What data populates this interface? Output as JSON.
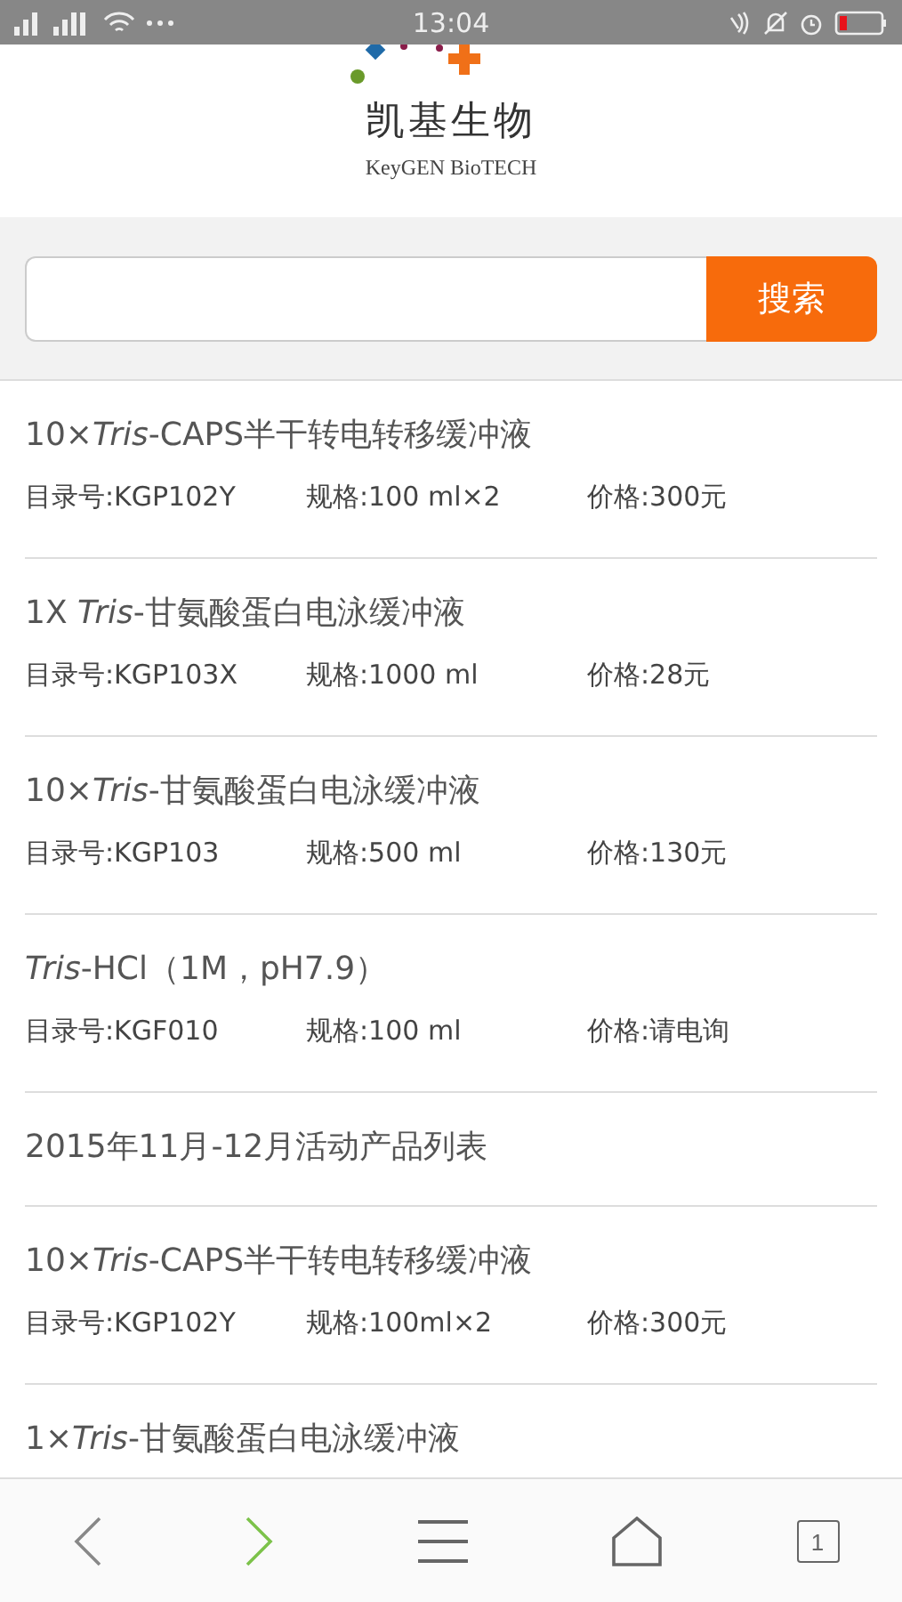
{
  "status_bar": {
    "time": "13:04"
  },
  "logo": {
    "name": "凯基生物",
    "tagline": "KeyGEN BioTECH"
  },
  "search": {
    "button": "搜索"
  },
  "items": [
    {
      "kind": "product",
      "title": "10×*Tris*-CAPS半干转电转移缓冲液",
      "catalog": "目录号:KGP102Y",
      "spec": "规格:100 ml×2",
      "price": "价格:300元"
    },
    {
      "kind": "product",
      "title": "1X *Tris*-甘氨酸蛋白电泳缓冲液",
      "catalog": "目录号:KGP103X",
      "spec": "规格:1000 ml",
      "price": "价格:28元"
    },
    {
      "kind": "product",
      "title": "10×*Tris*-甘氨酸蛋白电泳缓冲液",
      "catalog": "目录号:KGP103",
      "spec": "规格:500 ml",
      "price": "价格:130元"
    },
    {
      "kind": "product",
      "title": "*Tris*-HCl（1M，pH7.9）",
      "catalog": "目录号:KGF010",
      "spec": "规格:100 ml",
      "price": "价格:请电询"
    },
    {
      "kind": "heading",
      "title": "2015年11月-12月活动产品列表"
    },
    {
      "kind": "product",
      "title": "10×*Tris*-CAPS半干转电转移缓冲液",
      "catalog": "目录号:KGP102Y",
      "spec": "规格:100ml×2",
      "price": "价格:300元"
    },
    {
      "kind": "product",
      "title": "1×*Tris*-甘氨酸蛋白电泳缓冲液"
    }
  ],
  "nav": [
    {
      "kind": "back",
      "enabled": false
    },
    {
      "kind": "forward",
      "enabled": true
    },
    {
      "kind": "menu",
      "enabled": true
    },
    {
      "kind": "home",
      "enabled": true
    },
    {
      "kind": "tabs",
      "enabled": true,
      "count": "1"
    }
  ]
}
